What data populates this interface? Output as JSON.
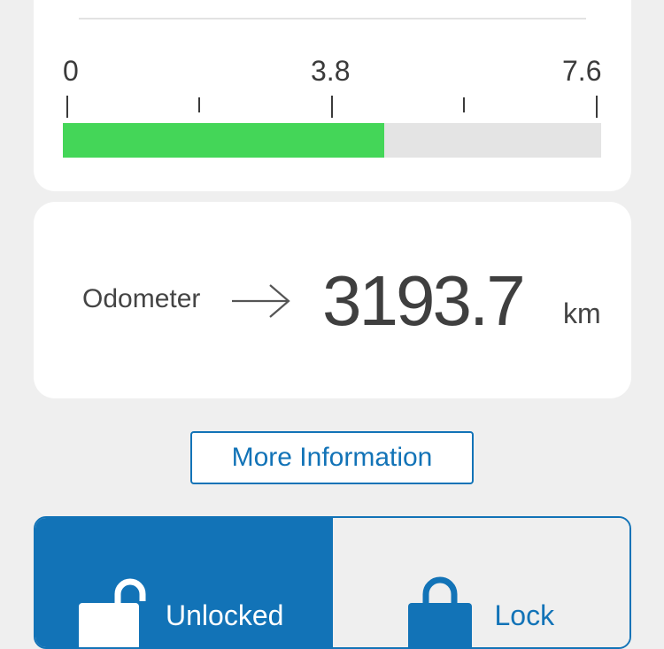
{
  "gauge": {
    "min_label": "0",
    "mid_label": "3.8",
    "max_label": "7.6",
    "fill_fraction": 0.597,
    "fill_color": "#44d658",
    "track_color": "#e4e4e4"
  },
  "odometer": {
    "label": "Odometer",
    "arrow_icon": "arrow-right-icon",
    "value": "3193.7",
    "unit": "km"
  },
  "more_info": {
    "label": "More Information"
  },
  "lock_control": {
    "accent_color": "#1273b7",
    "unlocked": {
      "label": "Unlocked",
      "icon": "unlocked-padlock-icon",
      "selected": true
    },
    "lock": {
      "label": "Lock",
      "icon": "locked-padlock-icon",
      "selected": false
    }
  }
}
